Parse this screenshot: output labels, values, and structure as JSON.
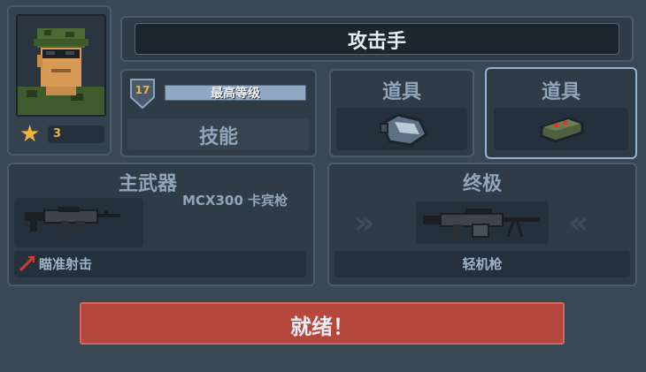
{
  "character": {
    "name": "攻击手",
    "stars": "3",
    "level": "17",
    "level_status": "最高等级",
    "skill_label": "技能"
  },
  "items": [
    {
      "label": "道具",
      "icon": "canister-grenade-icon"
    },
    {
      "label": "道具",
      "icon": "landmine-icon"
    }
  ],
  "primary_weapon": {
    "title": "主武器",
    "weapon_name": "MCX300 卡宾枪",
    "perk": "瞄准射击",
    "icon": "carbine-rifle-icon"
  },
  "ultimate": {
    "title": "终极",
    "weapon_name": "轻机枪",
    "icon": "light-machine-gun-icon"
  },
  "ready_button": "就绪！",
  "colors": {
    "ready": "#b5473d",
    "star": "#f2b33b",
    "selected_border": "#8fb4d6"
  }
}
